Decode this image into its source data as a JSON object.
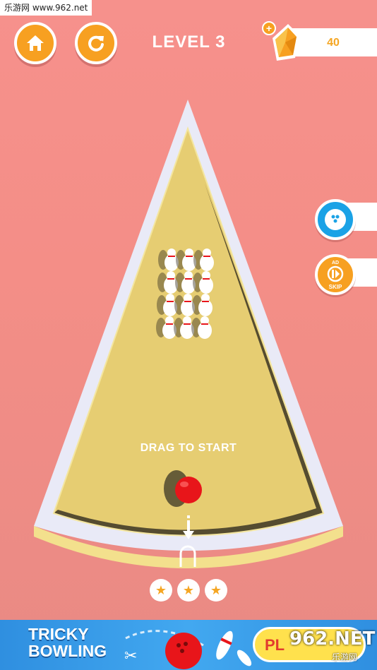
{
  "watermark_top": "乐游网 www.962.net",
  "hud": {
    "level_label": "LEVEL 3",
    "gem_count": "40",
    "plus_symbol": "+"
  },
  "side_buttons": {
    "skip_ad_label": "AD",
    "skip_label": "SKIP"
  },
  "prompt": "DRAG TO START",
  "stars": {
    "glyph": "★",
    "count": 3
  },
  "ad": {
    "title_line1": "TRICKY",
    "title_line2": "BOWLING",
    "play_label": "PL",
    "watermark_962": "962.NET",
    "watermark_site": "乐游网"
  },
  "colors": {
    "background": "#f48e87",
    "accent_orange": "#f7a021",
    "accent_blue": "#1aa2e6",
    "lane": "#e6cd72",
    "ball": "#e8151a",
    "ad_blue": "#3a9cec"
  },
  "icons": {
    "home": "home-icon",
    "restart": "restart-icon",
    "gem": "gem-icon",
    "dots": "ball-dots-icon",
    "skip": "skip-icon",
    "arrow": "down-arrow-icon",
    "star": "star-icon"
  }
}
